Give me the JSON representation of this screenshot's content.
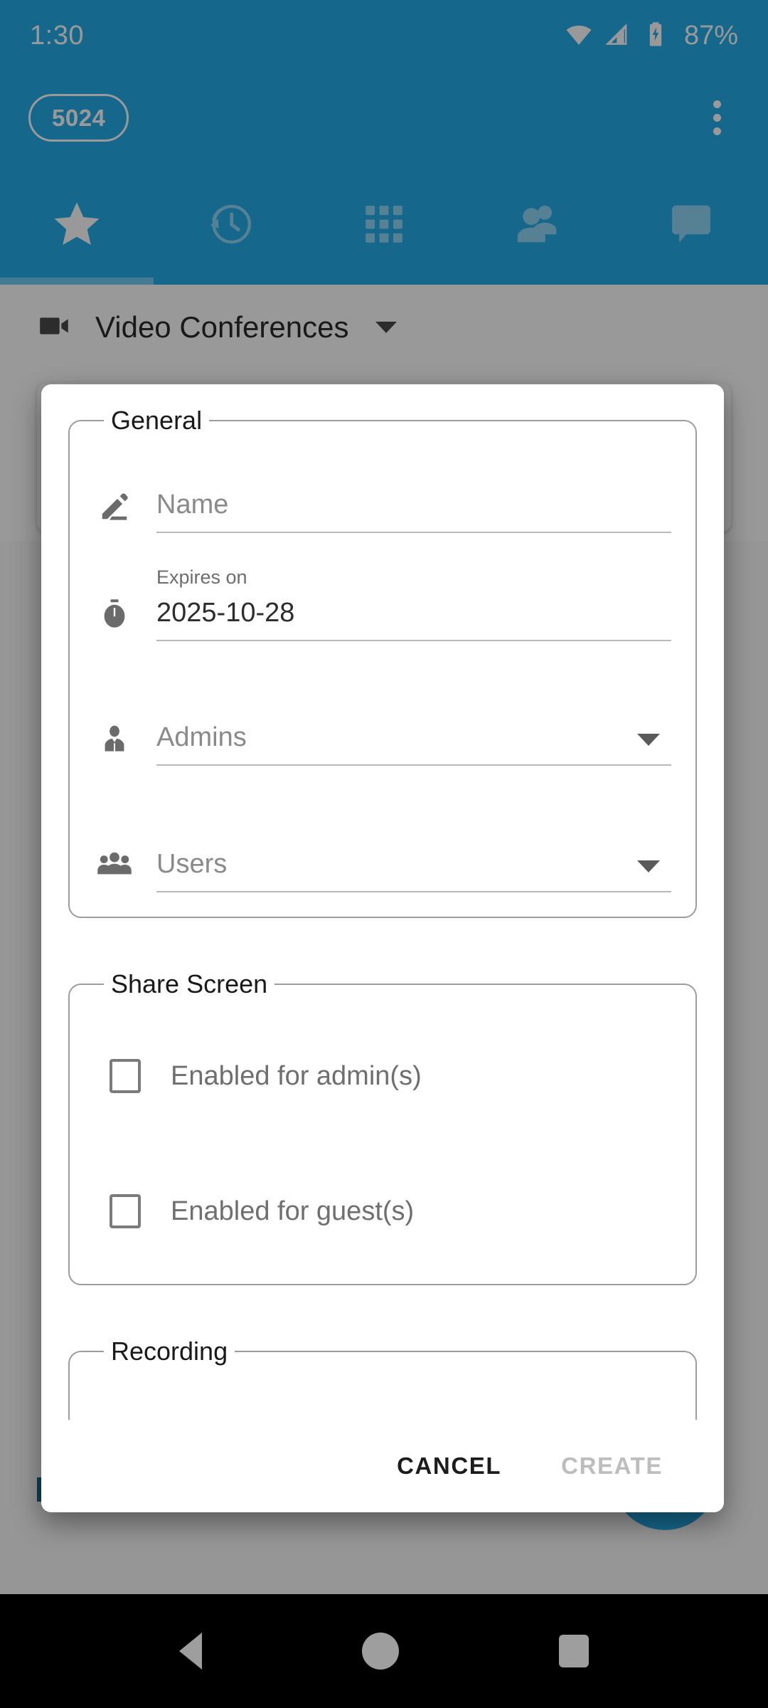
{
  "status_bar": {
    "time": "1:30",
    "battery_percent": "87%",
    "icons": [
      "wifi-icon",
      "cellular-signal-icon",
      "battery-charging-icon"
    ]
  },
  "app_bar": {
    "extension_chip": "5024",
    "overflow_icon": "more-vert-icon"
  },
  "tabs": [
    {
      "name": "favorites",
      "icon": "star-icon",
      "active": true
    },
    {
      "name": "history",
      "icon": "history-clock-icon",
      "active": false
    },
    {
      "name": "dialpad",
      "icon": "dialpad-grid-icon",
      "active": false
    },
    {
      "name": "contacts",
      "icon": "people-icon",
      "active": false
    },
    {
      "name": "chat",
      "icon": "chat-bubble-icon",
      "active": false
    }
  ],
  "background_screen": {
    "section_icon": "video-camera-icon",
    "section_title": "Video Conferences",
    "section_caret": "chevron-down-icon"
  },
  "dialog": {
    "groups": [
      {
        "legend": "General",
        "fields": [
          {
            "name": "name",
            "icon": "pencil-edit-icon",
            "sublabel": "",
            "placeholder": "Name",
            "value": "",
            "has_caret": false
          },
          {
            "name": "expires-on",
            "icon": "stopwatch-timer-icon",
            "sublabel": "Expires on",
            "placeholder": "",
            "value": "2025-10-28",
            "has_caret": false
          },
          {
            "name": "admins",
            "icon": "person-tie-icon",
            "sublabel": "",
            "placeholder": "Admins",
            "value": "",
            "has_caret": true
          },
          {
            "name": "users",
            "icon": "group-people-icon",
            "sublabel": "",
            "placeholder": "Users",
            "value": "",
            "has_caret": true
          }
        ]
      },
      {
        "legend": "Share Screen",
        "checkboxes": [
          {
            "name": "enabled-for-admins",
            "label": "Enabled for admin(s)",
            "checked": false
          },
          {
            "name": "enabled-for-guests",
            "label": "Enabled for guest(s)",
            "checked": false
          }
        ]
      },
      {
        "legend": "Recording",
        "checkboxes": []
      }
    ],
    "actions": {
      "cancel_label": "CANCEL",
      "create_label": "CREATE",
      "create_disabled": true
    }
  },
  "nav_bar": {
    "back": "back-triangle-icon",
    "home": "home-circle-icon",
    "recents": "recents-square-icon"
  },
  "colors": {
    "primary_blue": "#24ACE9",
    "tab_indicator": "#6FCDF5",
    "tab_inactive": "#8FD6F5",
    "text_primary": "#1A1A1A",
    "text_secondary": "#6D6D6D",
    "placeholder": "#8A8A8A",
    "disabled": "#BDBDBD",
    "scrim": "rgba(0,0,0,0.40)"
  }
}
